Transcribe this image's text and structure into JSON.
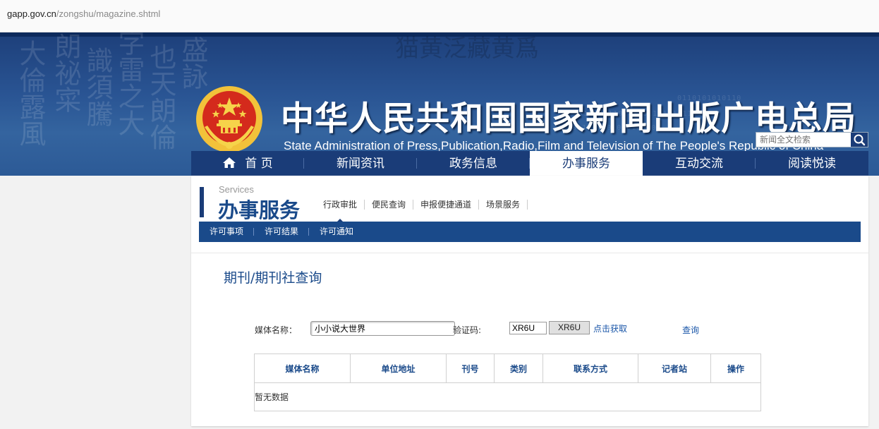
{
  "browser": {
    "url_domain": "gapp.gov.cn",
    "url_path": "/zongshu/magazine.shtml"
  },
  "header": {
    "title_cn": "中华人民共和国国家新闻出版广电总局",
    "title_en": "State Administration of Press,Publication,Radio,Film and Television of The People's Republic of China",
    "search_placeholder": "新闻全文检索",
    "search_icon": "magnifier-icon",
    "emblem_icon": "national-emblem-icon"
  },
  "nav": {
    "items": [
      {
        "label": "首 页",
        "icon": "home-icon"
      },
      {
        "label": "新闻资讯"
      },
      {
        "label": "政务信息"
      },
      {
        "label": "办事服务",
        "active": true
      },
      {
        "label": "互动交流"
      },
      {
        "label": "阅读悦读"
      }
    ]
  },
  "section": {
    "label_en": "Services",
    "title": "办事服务",
    "links": [
      "行政审批",
      "便民查询",
      "申报便捷通道",
      "场景服务"
    ],
    "active_link": "行政审批",
    "subnav": [
      "许可事项",
      "许可结果",
      "许可通知"
    ]
  },
  "query": {
    "page_title": "期刊/期刊社查询",
    "media_name_label": "媒体名称：",
    "media_name_value": "小小说大世界",
    "code_label": "验证码:",
    "code_value": "XR6U",
    "code_image_text": "XR6U",
    "get_code_link": "点击获取",
    "query_link": "查询"
  },
  "table": {
    "headers": [
      "媒体名称",
      "单位地址",
      "刊号",
      "类别",
      "联系方式",
      "记者站",
      "操作"
    ],
    "empty_text": "暂无数据"
  },
  "colors": {
    "primary": "#1a3c78",
    "accent": "#1a4a8a",
    "link": "#1a56a8",
    "emblem_red": "#d42a1c",
    "emblem_gold": "#f2c23a"
  }
}
